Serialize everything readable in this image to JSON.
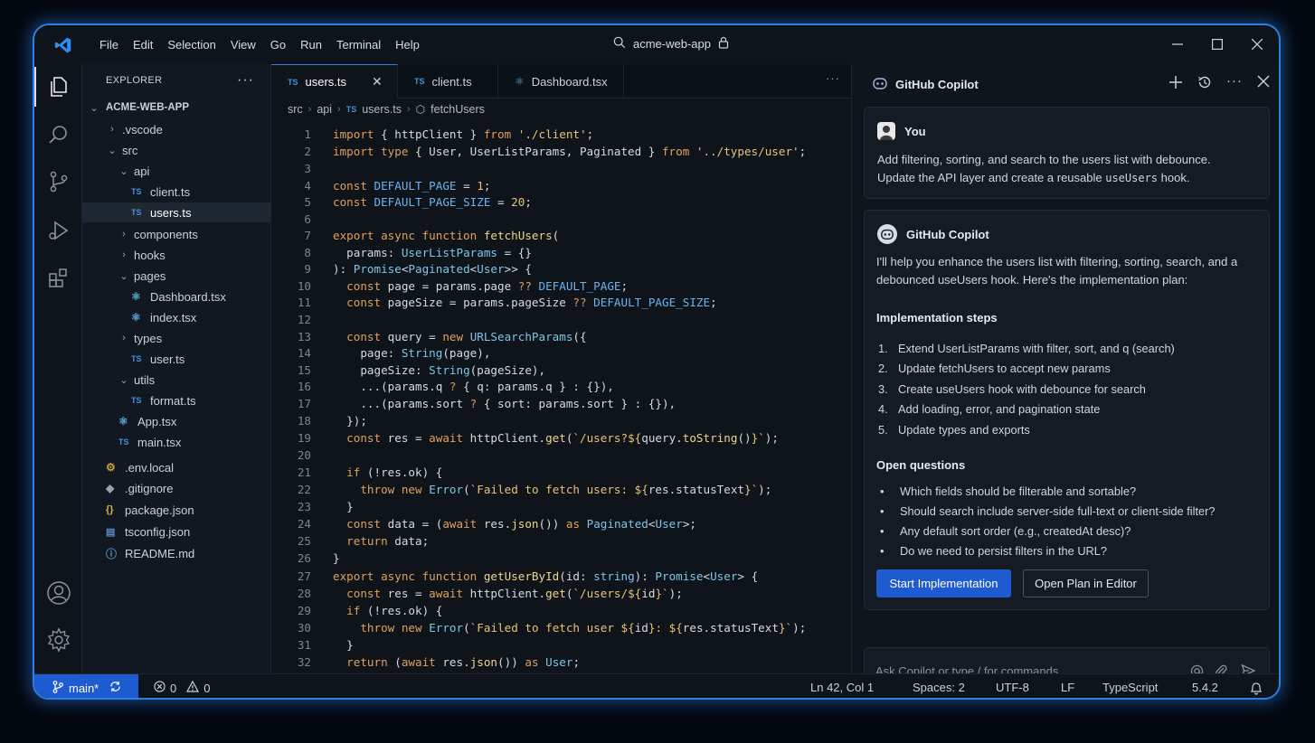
{
  "window": {
    "menu": [
      "File",
      "Edit",
      "Selection",
      "View",
      "Go",
      "Run",
      "Terminal",
      "Help"
    ],
    "command_center": "acme-web-app"
  },
  "explorer": {
    "header": "EXPLORER",
    "root": "ACME-WEB-APP",
    "items": [
      {
        "label": ".vscode"
      },
      {
        "label": "src"
      },
      {
        "label": "api"
      },
      {
        "label": "client.ts"
      },
      {
        "label": "users.ts"
      },
      {
        "label": "components"
      },
      {
        "label": "hooks"
      },
      {
        "label": "pages"
      },
      {
        "label": "Dashboard.tsx"
      },
      {
        "label": "index.tsx"
      },
      {
        "label": "types"
      },
      {
        "label": "user.ts"
      },
      {
        "label": "utils"
      },
      {
        "label": "format.ts"
      },
      {
        "label": "App.tsx"
      },
      {
        "label": "main.tsx"
      },
      {
        "label": ".env.local"
      },
      {
        "label": ".gitignore"
      },
      {
        "label": "package.json"
      },
      {
        "label": "tsconfig.json"
      },
      {
        "label": "README.md"
      }
    ]
  },
  "editor": {
    "tabs": [
      {
        "label": "users.ts",
        "badge": "TS"
      },
      {
        "label": "client.ts",
        "badge": "TS"
      },
      {
        "label": "Dashboard.tsx"
      }
    ],
    "breadcrumb": [
      "src",
      "api",
      "users.ts",
      "fetchUsers"
    ],
    "ts_badge": "TS",
    "line_numbers": [
      "1",
      "2",
      "3",
      "4",
      "5",
      "6",
      "7",
      "8",
      "9",
      "10",
      "11",
      "12",
      "13",
      "14",
      "15",
      "16",
      "17",
      "18",
      "19",
      "20",
      "21",
      "22",
      "23",
      "24",
      "25",
      "26",
      "27",
      "28",
      "29",
      "30",
      "31",
      "32"
    ]
  },
  "copilot": {
    "title": "GitHub Copilot",
    "user_name": "You",
    "user_message_1": "Add filtering, sorting, and search to the users list with debounce.",
    "user_message_2a": "Update the API layer and create a reusable ",
    "user_message_2b": "useUsers",
    "user_message_2c": " hook.",
    "assistant_name": "GitHub Copilot",
    "intro_1": "I'll help you enhance the users list with filtering, sorting, search, and a",
    "intro_2": "debounced useUsers hook. Here's the implementation plan:",
    "steps_heading": "Implementation steps",
    "steps": [
      "Extend UserListParams with filter, sort, and q (search)",
      "Update fetchUsers to accept new params",
      "Create useUsers hook with debounce for search",
      "Add loading, error, and pagination state",
      "Update types and exports"
    ],
    "step_numbers": [
      "1.",
      "2.",
      "3.",
      "4.",
      "5."
    ],
    "questions_heading": "Open questions",
    "questions": [
      "Which fields should be filterable and sortable?",
      "Should search include server-side full-text or client-side filter?",
      "Any default sort order (e.g., createdAt desc)?",
      "Do we need to persist filters in the URL?"
    ],
    "primary_button": "Start Implementation",
    "secondary_button": "Open Plan in Editor",
    "input_placeholder": "Ask Copilot or type / for commands"
  },
  "statusbar": {
    "branch": "main*",
    "errors": "0",
    "warnings": "0",
    "position": "Ln 42, Col 1",
    "spaces": "Spaces: 2",
    "encoding": "UTF-8",
    "eol": "LF",
    "language": "TypeScript",
    "version": "5.4.2"
  },
  "colors": {
    "accent": "#1e5bd1",
    "frame_glow": "#2f7fe0",
    "background": "#0f141b"
  }
}
